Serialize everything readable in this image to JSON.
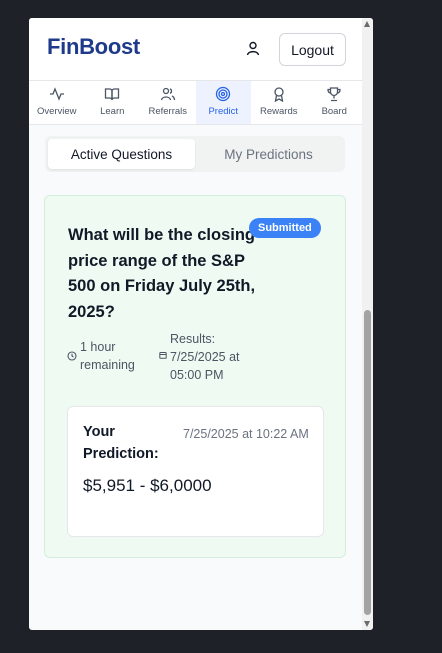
{
  "app": {
    "logo": "FinBoost",
    "logout_label": "Logout"
  },
  "nav": {
    "items": [
      {
        "label": "Overview",
        "icon": "activity-icon",
        "active": false
      },
      {
        "label": "Learn",
        "icon": "book-icon",
        "active": false
      },
      {
        "label": "Referrals",
        "icon": "users-icon",
        "active": false
      },
      {
        "label": "Predict",
        "icon": "target-icon",
        "active": true
      },
      {
        "label": "Rewards",
        "icon": "award-icon",
        "active": false
      },
      {
        "label": "Board",
        "icon": "trophy-icon",
        "active": false
      }
    ]
  },
  "tabs": {
    "active": "Active Questions",
    "inactive": "My Predictions"
  },
  "question": {
    "text": "What will be the closing price range of the S&P 500 on Friday July 25th, 2025?",
    "badge": "Submitted",
    "time_remaining": "1 hour remaining",
    "results_label": "Results:",
    "results_time": "7/25/2025 at 05:00 PM"
  },
  "prediction": {
    "label": "Your Prediction:",
    "timestamp": "7/25/2025 at 10:22 AM",
    "value": "$5,951 - $6,0000"
  },
  "colors": {
    "accent": "#3b82f6",
    "brand": "#1e3a8a",
    "card_bg": "#effbf2"
  }
}
